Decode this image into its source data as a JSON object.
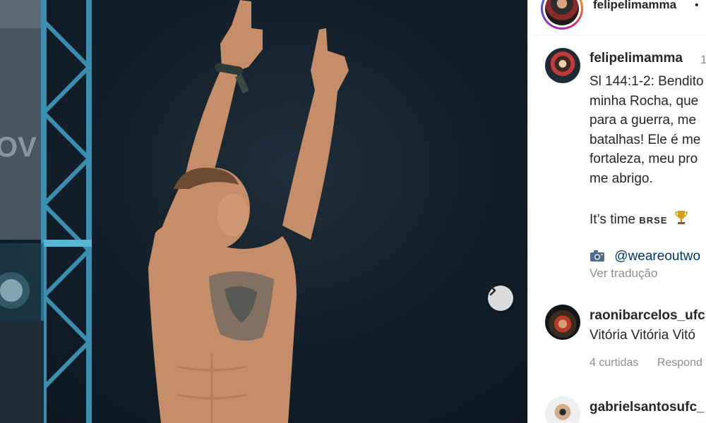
{
  "post": {
    "header_username": "felipelimamma",
    "header_separator": "•",
    "next_icon": "chevron-right-icon"
  },
  "caption": {
    "username": "felipelimamma",
    "time": "1",
    "lines": [
      "Sl 144:1-2: Bendito",
      "minha Rocha, que",
      "para a guerra, me",
      "batalhas! Ele é me",
      "fortaleza, meu pro",
      "me abrigo."
    ],
    "its_time": "It’s time",
    "brse": "BRSE",
    "trophy_icon": "trophy-icon",
    "camera_icon": "camera-icon",
    "credit": "@weareoutwo",
    "translate": "Ver tradução"
  },
  "comments": [
    {
      "username": "raonibarcelos_ufc",
      "text": "Vitória Vitória Vitó",
      "likes": "4 curtidas",
      "reply": "Respond"
    },
    {
      "username": "gabrielsantosufc_"
    }
  ],
  "colors": {
    "link": "#00376b",
    "muted": "#8e8e8e",
    "text": "#262626"
  }
}
